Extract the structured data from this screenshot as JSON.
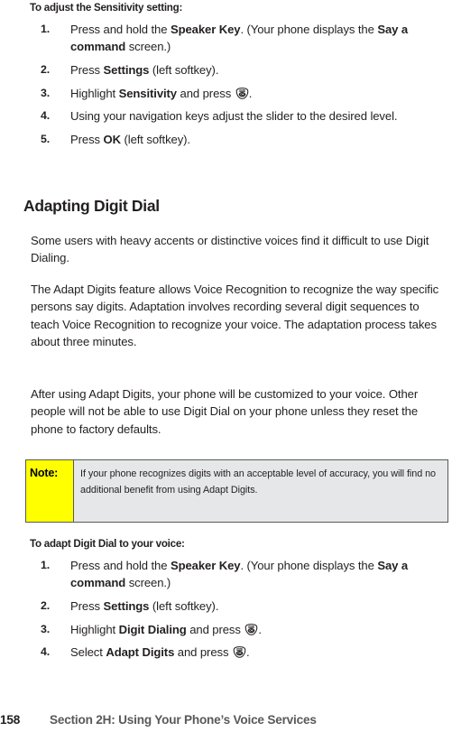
{
  "page": {
    "number": "158",
    "section_ref": "Section 2H: Using Your Phone’s Voice Services"
  },
  "icons": {
    "menu_ok_key": "menu-ok-key-icon",
    "menu_label": "MENU",
    "ok_label": "OK"
  },
  "procedure_sensitivity": {
    "lead_in": "To adjust the Sensitivity setting:",
    "steps": [
      {
        "num": "1.",
        "parts": [
          {
            "t": "Press and hold the ",
            "b": false
          },
          {
            "t": "Speaker Key",
            "b": true
          },
          {
            "t": ". (Your phone displays the ",
            "b": false
          },
          {
            "t": "Say a command",
            "b": true
          },
          {
            "t": " screen.)",
            "b": false
          }
        ]
      },
      {
        "num": "2.",
        "parts": [
          {
            "t": "Press ",
            "b": false
          },
          {
            "t": "Settings",
            "b": true
          },
          {
            "t": " (left softkey).",
            "b": false
          }
        ]
      },
      {
        "num": "3.",
        "parts": [
          {
            "t": "Highlight ",
            "b": false
          },
          {
            "t": "Sensitivity",
            "b": true
          },
          {
            "t": " and press ",
            "b": false
          },
          {
            "icon": "menu-ok-key-icon"
          },
          {
            "t": ".",
            "b": false
          }
        ]
      },
      {
        "num": "4.",
        "parts": [
          {
            "t": "Using your navigation keys adjust the slider to the desired level.",
            "b": false
          }
        ]
      },
      {
        "num": "5.",
        "parts": [
          {
            "t": "Press ",
            "b": false
          },
          {
            "t": "OK",
            "b": true
          },
          {
            "t": " (left softkey).",
            "b": false
          }
        ]
      }
    ]
  },
  "section": {
    "title": "Adapting Digit Dial",
    "paragraphs": [
      "Some users with heavy accents or distinctive voices find it difficult to use Digit Dialing.",
      "The Adapt Digits feature allows Voice Recognition to recognize the way specific persons say digits. Adaptation involves recording several digit sequences to teach Voice Recognition to recognize your voice. The adaptation process takes about three minutes.",
      "After using Adapt Digits, your phone will be customized to your voice. Other people will not be able to use Digit Dial on your phone unless they reset the phone to factory defaults."
    ]
  },
  "note": {
    "label": "Note:",
    "text": "If your phone recognizes digits with an acceptable level of accuracy, you will find no additional benefit from using Adapt Digits.",
    "label_bg": "#ffff00",
    "body_bg": "#e6e7e8",
    "border": "#58595b"
  },
  "procedure_adapt": {
    "lead_in": "To adapt Digit Dial to your voice:",
    "steps": [
      {
        "num": "1.",
        "parts": [
          {
            "t": "Press and hold the ",
            "b": false
          },
          {
            "t": "Speaker Key",
            "b": true
          },
          {
            "t": ". (Your phone displays the ",
            "b": false
          },
          {
            "t": "Say a command",
            "b": true
          },
          {
            "t": " screen.)",
            "b": false
          }
        ]
      },
      {
        "num": "2.",
        "parts": [
          {
            "t": "Press ",
            "b": false
          },
          {
            "t": "Settings",
            "b": true
          },
          {
            "t": " (left softkey).",
            "b": false
          }
        ]
      },
      {
        "num": "3.",
        "parts": [
          {
            "t": "Highlight ",
            "b": false
          },
          {
            "t": "Digit Dialing",
            "b": true
          },
          {
            "t": " and press ",
            "b": false
          },
          {
            "icon": "menu-ok-key-icon"
          },
          {
            "t": ".",
            "b": false
          }
        ]
      },
      {
        "num": "4.",
        "parts": [
          {
            "t": "Select ",
            "b": false
          },
          {
            "t": "Adapt Digits",
            "b": true
          },
          {
            "t": " and press ",
            "b": false
          },
          {
            "icon": "menu-ok-key-icon"
          },
          {
            "t": ".",
            "b": false
          }
        ]
      }
    ]
  }
}
